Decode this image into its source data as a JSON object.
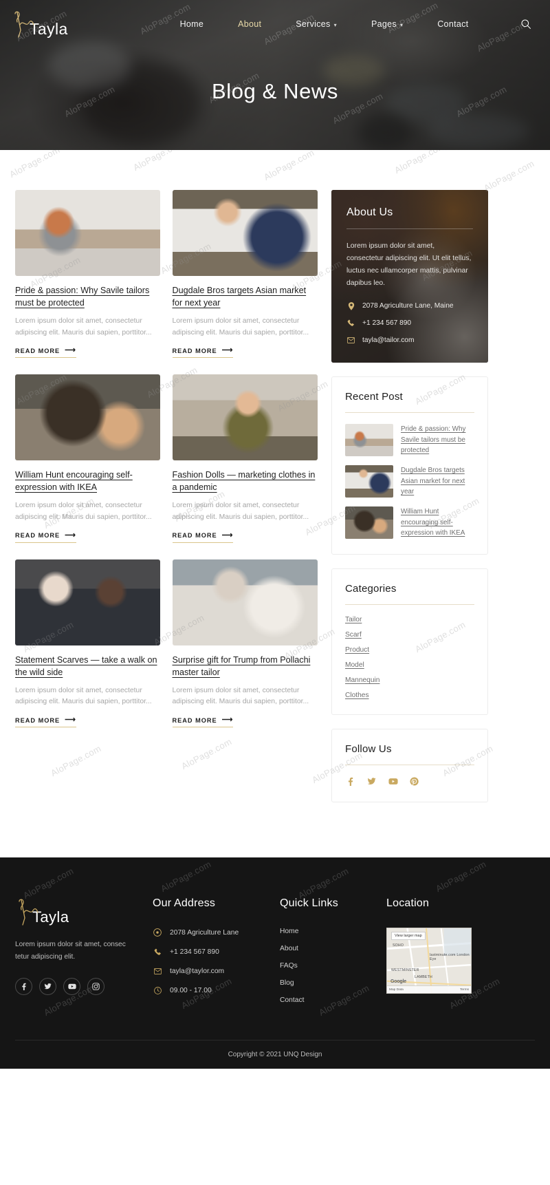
{
  "site": {
    "brand": "Tayla",
    "logo_icon": "needle-thread-icon"
  },
  "nav": {
    "items": [
      {
        "label": "Home",
        "has_caret": false,
        "active": false
      },
      {
        "label": "About",
        "has_caret": false,
        "active": true
      },
      {
        "label": "Services",
        "has_caret": true,
        "active": false
      },
      {
        "label": "Pages",
        "has_caret": true,
        "active": false
      },
      {
        "label": "Contact",
        "has_caret": false,
        "active": false
      }
    ],
    "search_icon": "search-icon"
  },
  "hero": {
    "title": "Blog & News"
  },
  "watermark": {
    "text": "AloPage.com"
  },
  "posts": [
    {
      "title": "Pride & passion: Why Savile tailors must be protected",
      "excerpt": "Lorem ipsum dolor sit amet, consectetur adipiscing elit. Mauris dui sapien, porttitor...",
      "read_more": "READ MORE"
    },
    {
      "title": "Dugdale Bros targets Asian market for next year",
      "excerpt": "Lorem ipsum dolor sit amet, consectetur adipiscing elit. Mauris dui sapien, porttitor...",
      "read_more": "READ MORE"
    },
    {
      "title": "William Hunt encouraging self-expression with IKEA",
      "excerpt": "Lorem ipsum dolor sit amet, consectetur adipiscing elit. Mauris dui sapien, porttitor...",
      "read_more": "READ MORE"
    },
    {
      "title": "Fashion Dolls — marketing clothes in a pandemic",
      "excerpt": "Lorem ipsum dolor sit amet, consectetur adipiscing elit. Mauris dui sapien, porttitor...",
      "read_more": "READ MORE"
    },
    {
      "title": "Statement Scarves — take a walk on the wild side",
      "excerpt": "Lorem ipsum dolor sit amet, consectetur adipiscing elit. Mauris dui sapien, porttitor...",
      "read_more": "READ MORE"
    },
    {
      "title": "Surprise gift for Trump from Pollachi master tailor",
      "excerpt": "Lorem ipsum dolor sit amet, consectetur adipiscing elit. Mauris dui sapien, porttitor...",
      "read_more": "READ MORE"
    }
  ],
  "sidebar": {
    "about": {
      "title": "About Us",
      "text": "Lorem ipsum dolor sit amet, consectetur adipiscing elit. Ut elit tellus, luctus nec ullamcorper mattis, pulvinar dapibus leo.",
      "address": "2078 Agriculture Lane, Maine",
      "phone": "+1 234 567 890",
      "email": "tayla@tailor.com",
      "address_icon": "map-pin-icon",
      "phone_icon": "phone-icon",
      "email_icon": "envelope-icon"
    },
    "recent": {
      "title": "Recent Post",
      "items": [
        {
          "title": "Pride & passion: Why Savile tailors must be protected"
        },
        {
          "title": "Dugdale Bros targets Asian market for next year"
        },
        {
          "title": "William Hunt encouraging self-expression with IKEA"
        }
      ]
    },
    "categories": {
      "title": "Categories",
      "items": [
        "Tailor",
        "Scarf",
        "Product",
        "Model",
        "Mannequin",
        "Clothes"
      ]
    },
    "follow": {
      "title": "Follow Us",
      "socials": [
        "facebook-icon",
        "twitter-icon",
        "youtube-icon",
        "pinterest-icon"
      ]
    }
  },
  "footer": {
    "brand": "Tayla",
    "about": "Lorem ipsum dolor sit amet, consec tetur adipiscing elit.",
    "socials": [
      "facebook-icon",
      "twitter-icon",
      "youtube-icon",
      "instagram-icon"
    ],
    "address": {
      "heading": "Our Address",
      "items": [
        {
          "icon": "map-pin-icon",
          "text": "2078 Agriculture Lane"
        },
        {
          "icon": "phone-icon",
          "text": "+1 234 567 890"
        },
        {
          "icon": "envelope-icon",
          "text": "tayla@taylor.com"
        },
        {
          "icon": "clock-icon",
          "text": "09.00 - 17.00"
        }
      ]
    },
    "quick_links": {
      "heading": "Quick Links",
      "items": [
        "Home",
        "About",
        "FAQs",
        "Blog",
        "Contact"
      ]
    },
    "location": {
      "heading": "Location",
      "map": {
        "view_larger": "View larger map",
        "labels": [
          "SOHO",
          "lastminute.com London Eye",
          "WESTMINSTER",
          "LAMBETH"
        ],
        "brand": "Google",
        "map_data": "Map Data",
        "terms": "Terms"
      }
    },
    "copyright": "Copyright © 2021 UNQ Design"
  },
  "colors": {
    "accent": "#c9a961",
    "dark": "#151515",
    "muted": "#a6a6a6"
  }
}
